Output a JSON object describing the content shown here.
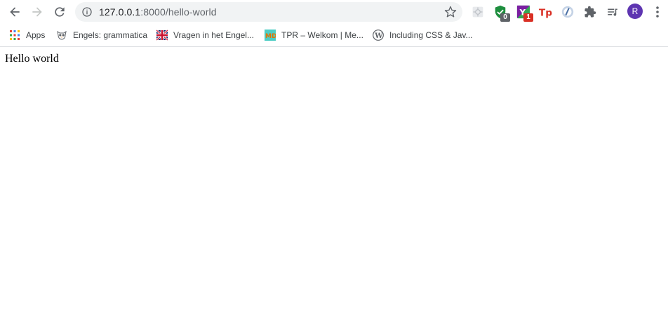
{
  "toolbar": {
    "url_host": "127.0.0.1",
    "url_path": ":8000/hello-world",
    "extensions": [
      {
        "name": "dev-tools-extension-icon",
        "badge": ""
      },
      {
        "name": "shield-check-extension-icon",
        "badge": "0",
        "badge_color": "#5f6368"
      },
      {
        "name": "y-extension-icon",
        "badge": "1",
        "badge_color": "#d93025"
      },
      {
        "name": "tp-extension-icon",
        "badge": ""
      },
      {
        "name": "circle-extension-icon",
        "badge": ""
      },
      {
        "name": "puzzle-extensions-icon",
        "badge": ""
      },
      {
        "name": "reading-list-icon",
        "badge": ""
      }
    ],
    "avatar_initial": "R",
    "avatar_color": "#5e35b1"
  },
  "bookmarks": [
    {
      "label": "Apps",
      "icon": "apps-grid-icon"
    },
    {
      "label": "Engels: grammatica",
      "icon": "owl-icon"
    },
    {
      "label": "Vragen in het Engel...",
      "icon": "uk-flag-icon"
    },
    {
      "label": "TPR – Welkom | Me...",
      "icon": "md-icon"
    },
    {
      "label": "Including CSS & Jav...",
      "icon": "wordpress-icon"
    }
  ],
  "page": {
    "text": "Hello world"
  },
  "colors": {
    "accent_green": "#1e8e3e",
    "accent_red": "#d93025",
    "icon_gray": "#5f6368"
  }
}
